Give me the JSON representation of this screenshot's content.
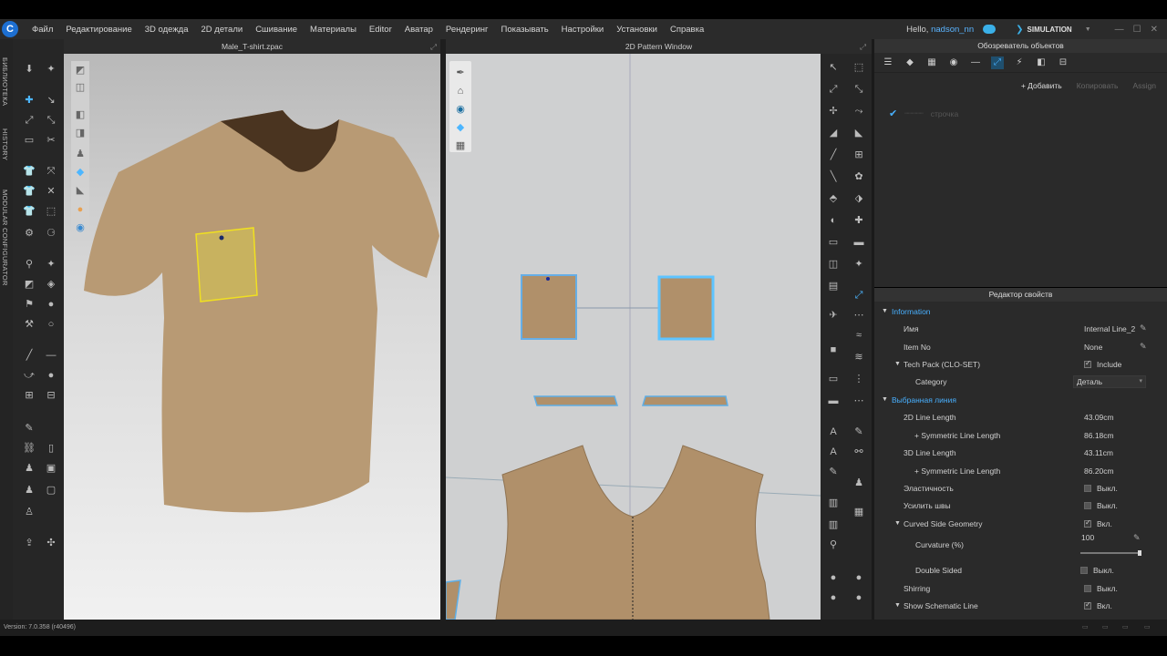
{
  "menu": [
    "Файл",
    "Редактирование",
    "3D одежда",
    "2D детали",
    "Сшивание",
    "Материалы",
    "Editor",
    "Аватар",
    "Рендеринг",
    "Показывать",
    "Настройки",
    "Установки",
    "Справка"
  ],
  "user": {
    "hello": "Hello,",
    "name": "nadson_nn"
  },
  "mode": {
    "label": "SIMULATION"
  },
  "side_tabs": [
    "БИБЛИОТЕКА",
    "HISTORY",
    "MODULAR CONFIGURATOR"
  ],
  "view3d": {
    "title": "Male_T-shirt.zpac"
  },
  "view2d": {
    "title": "2D Pattern Window"
  },
  "explorer": {
    "title": "Обозреватель объектов",
    "add": "+ Добавить",
    "copy": "Копировать",
    "assign": "Assign",
    "item": "строчка"
  },
  "props": {
    "title": "Редактор свойств",
    "information": "Information",
    "name_label": "Имя",
    "name_value": "Internal Line_2",
    "itemno_label": "Item No",
    "itemno_value": "None",
    "techpack_label": "Tech Pack (CLO-SET)",
    "techpack_value": "Include",
    "category_label": "Category",
    "category_value": "Деталь",
    "selected_line": "Выбранная линия",
    "len2d_label": "2D Line Length",
    "len2d_value": "43.09cm",
    "sym2d_label": "+ Symmetric Line Length",
    "sym2d_value": "86.18cm",
    "len3d_label": "3D Line Length",
    "len3d_value": "43.11cm",
    "sym3d_label": "+ Symmetric Line Length",
    "sym3d_value": "86.20cm",
    "elastic_label": "Эластичность",
    "elastic_value": "Выкл.",
    "strength_label": "Усилить швы",
    "strength_value": "Выкл.",
    "curved_label": "Curved Side Geometry",
    "curved_value": "Вкл.",
    "curvature_label": "Curvature (%)",
    "curvature_value": "100",
    "double_label": "Double Sided",
    "double_value": "Выкл.",
    "shirring_label": "Shirring",
    "shirring_value": "Выкл.",
    "schematic_label": "Show Schematic Line",
    "schematic_value": "Вкл."
  },
  "status": {
    "version": "Version: 7.0.358 (r40496)"
  },
  "colors": {
    "accent": "#48b0ff",
    "fabric": "#b89a74",
    "pattern": "#b0906a",
    "selection": "#e8e040"
  }
}
